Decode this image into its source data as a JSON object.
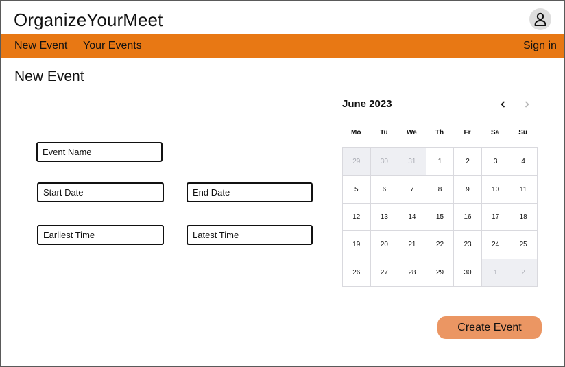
{
  "app": {
    "title": "OrganizeYourMeet"
  },
  "nav": {
    "new_event": "New Event",
    "your_events": "Your Events",
    "sign_in": "Sign in"
  },
  "page": {
    "title": "New Event"
  },
  "form": {
    "event_name_placeholder": "Event Name",
    "start_date_placeholder": "Start Date",
    "end_date_placeholder": "End Date",
    "earliest_time_placeholder": "Earliest Time",
    "latest_time_placeholder": "Latest Time"
  },
  "calendar": {
    "month_label": "June 2023",
    "weekdays": [
      "Mo",
      "Tu",
      "We",
      "Th",
      "Fr",
      "Sa",
      "Su"
    ],
    "days": [
      {
        "d": "29",
        "muted": true
      },
      {
        "d": "30",
        "muted": true
      },
      {
        "d": "31",
        "muted": true
      },
      {
        "d": "1"
      },
      {
        "d": "2"
      },
      {
        "d": "3"
      },
      {
        "d": "4"
      },
      {
        "d": "5"
      },
      {
        "d": "6"
      },
      {
        "d": "7"
      },
      {
        "d": "8"
      },
      {
        "d": "9"
      },
      {
        "d": "10"
      },
      {
        "d": "11"
      },
      {
        "d": "12"
      },
      {
        "d": "13"
      },
      {
        "d": "14"
      },
      {
        "d": "15"
      },
      {
        "d": "16"
      },
      {
        "d": "17"
      },
      {
        "d": "18"
      },
      {
        "d": "19"
      },
      {
        "d": "20"
      },
      {
        "d": "21"
      },
      {
        "d": "22"
      },
      {
        "d": "23"
      },
      {
        "d": "24"
      },
      {
        "d": "25"
      },
      {
        "d": "26"
      },
      {
        "d": "27"
      },
      {
        "d": "28"
      },
      {
        "d": "29"
      },
      {
        "d": "30"
      },
      {
        "d": "1",
        "muted": true
      },
      {
        "d": "2",
        "muted": true
      }
    ]
  },
  "actions": {
    "create_event": "Create Event"
  },
  "colors": {
    "navbar": "#e87814",
    "create_button": "#eb9663",
    "muted_cell": "#eeeff3"
  },
  "icons": {
    "avatar": "user-icon",
    "prev_month": "chevron-left-icon",
    "next_month": "chevron-right-icon"
  }
}
